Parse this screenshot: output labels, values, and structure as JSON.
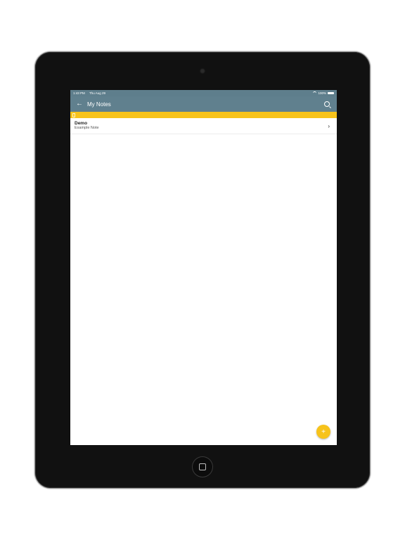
{
  "status_bar": {
    "time": "1:43 PM",
    "date": "Thu Aug 29",
    "battery": "100%"
  },
  "app_bar": {
    "title": "My Notes",
    "back_icon": "arrow-left-icon",
    "search_icon": "search-icon"
  },
  "notes": [
    {
      "title": "Demo",
      "subtitle": "Example Note"
    }
  ],
  "fab": {
    "label": "+"
  },
  "colors": {
    "app_bar": "#60808e",
    "accent": "#f7c31b"
  }
}
